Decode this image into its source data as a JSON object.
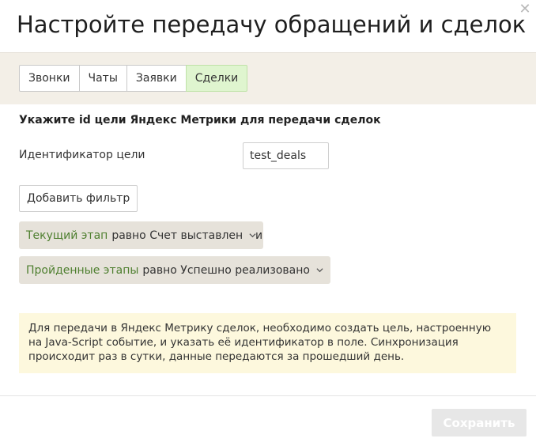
{
  "dialog": {
    "title": "Настройте передачу обращений и сделок",
    "close_icon": "close-icon"
  },
  "tabs": [
    {
      "label": "Звонки",
      "active": false
    },
    {
      "label": "Чаты",
      "active": false
    },
    {
      "label": "Заявки",
      "active": false
    },
    {
      "label": "Сделки",
      "active": true
    }
  ],
  "section": {
    "heading": "Укажите id цели Яндекс Метрики для передачи сделок",
    "goal_label": "Идентификатор цели",
    "goal_value": "test_deals"
  },
  "filters": {
    "add_button_label": "Добавить фильтр",
    "conjunction": "и",
    "items": [
      {
        "key": "Текущий этап",
        "rest": "равно Счет выставлен"
      },
      {
        "key": "Пройденные этапы",
        "rest": "равно Успешно реализовано"
      }
    ]
  },
  "note": {
    "text": "Для передачи в Яндекс Метрику сделок, необходимо создать цель, настроенную на Java-Script событие, и указать её идентификатор в поле. Синхронизация происходит раз в сутки, данные передаются за прошедший день."
  },
  "footer": {
    "save_label": "Сохранить"
  },
  "colors": {
    "tabs_bar_bg": "#f3efe7",
    "active_tab_bg": "#dff5cf",
    "chip_bg": "#e6e2da",
    "chip_key": "#4e7f2f",
    "note_bg": "#fdf8dd",
    "save_disabled_bg": "#e7e7e7"
  }
}
